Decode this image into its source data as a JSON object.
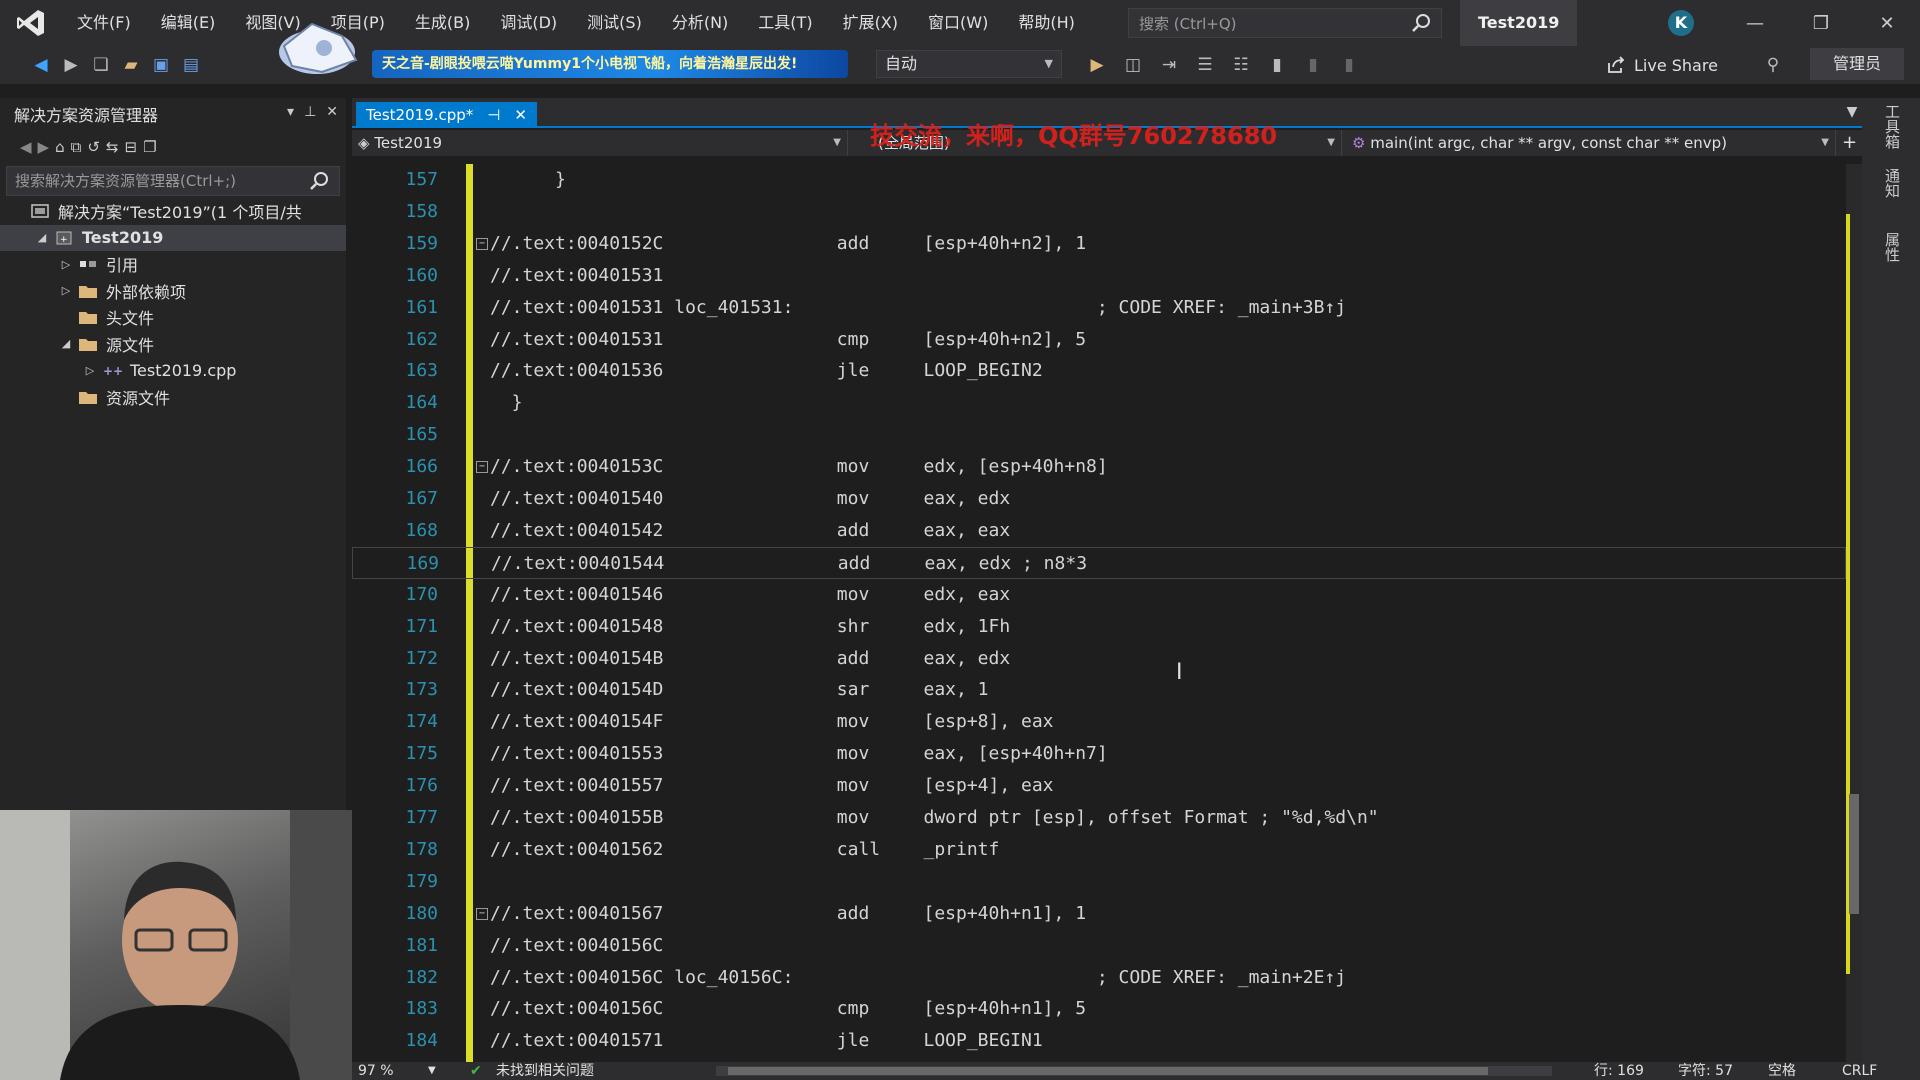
{
  "menu": [
    "文件(F)",
    "编辑(E)",
    "视图(V)",
    "项目(P)",
    "生成(B)",
    "调试(D)",
    "测试(S)",
    "分析(N)",
    "工具(T)",
    "扩展(X)",
    "窗口(W)",
    "帮助(H)"
  ],
  "title_search_placeholder": "搜索 (Ctrl+Q)",
  "solution_title": "Test2019",
  "account_initial": "K",
  "toolbar": {
    "banner_text": "天之音-剧眼投喂云喵Yummy1个小电视飞船，向着浩瀚星辰出发!",
    "config_value": "自动",
    "live_share": "Live Share",
    "admin_label": "管理员"
  },
  "solution_explorer": {
    "title": "解决方案资源管理器",
    "search_placeholder": "搜索解决方案资源管理器(Ctrl+;)",
    "items": [
      {
        "label": "解决方案“Test2019”(1 个项目/共",
        "indent": 0,
        "arrow": "",
        "icon": "solution-icon"
      },
      {
        "label": "Test2019",
        "indent": 1,
        "arrow": "◢",
        "icon": "project-icon",
        "bold": true,
        "selected": true
      },
      {
        "label": "引用",
        "indent": 2,
        "arrow": "▷",
        "icon": "references-icon"
      },
      {
        "label": "外部依赖项",
        "indent": 2,
        "arrow": "▷",
        "icon": "folder-icon"
      },
      {
        "label": "头文件",
        "indent": 2,
        "arrow": "",
        "icon": "folder-icon"
      },
      {
        "label": "源文件",
        "indent": 2,
        "arrow": "◢",
        "icon": "folder-icon"
      },
      {
        "label": "Test2019.cpp",
        "indent": 3,
        "arrow": "▷",
        "icon": "cpp-file-icon"
      },
      {
        "label": "资源文件",
        "indent": 2,
        "arrow": "",
        "icon": "folder-icon"
      }
    ]
  },
  "editor": {
    "tab_label": "Test2019.cpp*",
    "nav_project": "Test2019",
    "nav_scope": "(全局范围)",
    "nav_function": "main(int argc, char ** argv, const char ** envp)",
    "watermark": "技交流，来啊，QQ群号760278680",
    "current_line": 169,
    "lines": [
      {
        "n": "157",
        "text": "      }",
        "fold": false
      },
      {
        "n": "158",
        "text": "",
        "fold": false
      },
      {
        "n": "159",
        "text": "//.text:0040152C                add     [esp+40h+n2], 1",
        "fold": true
      },
      {
        "n": "160",
        "text": "//.text:00401531",
        "fold": false
      },
      {
        "n": "161",
        "text": "//.text:00401531 loc_401531:                            ; CODE XREF: _main+3B↑j",
        "fold": false
      },
      {
        "n": "162",
        "text": "//.text:00401531                cmp     [esp+40h+n2], 5",
        "fold": false
      },
      {
        "n": "163",
        "text": "//.text:00401536                jle     LOOP_BEGIN2",
        "fold": false
      },
      {
        "n": "164",
        "text": "  }",
        "fold": false
      },
      {
        "n": "165",
        "text": "",
        "fold": false
      },
      {
        "n": "166",
        "text": "//.text:0040153C                mov     edx, [esp+40h+n8]",
        "fold": true
      },
      {
        "n": "167",
        "text": "//.text:00401540                mov     eax, edx",
        "fold": false
      },
      {
        "n": "168",
        "text": "//.text:00401542                add     eax, eax",
        "fold": false
      },
      {
        "n": "169",
        "text": "//.text:00401544                add     eax, edx ; n8*3",
        "fold": false
      },
      {
        "n": "170",
        "text": "//.text:00401546                mov     edx, eax",
        "fold": false
      },
      {
        "n": "171",
        "text": "//.text:00401548                shr     edx, 1Fh",
        "fold": false
      },
      {
        "n": "172",
        "text": "//.text:0040154B                add     eax, edx",
        "fold": false
      },
      {
        "n": "173",
        "text": "//.text:0040154D                sar     eax, 1",
        "fold": false
      },
      {
        "n": "174",
        "text": "//.text:0040154F                mov     [esp+8], eax",
        "fold": false
      },
      {
        "n": "175",
        "text": "//.text:00401553                mov     eax, [esp+40h+n7]",
        "fold": false
      },
      {
        "n": "176",
        "text": "//.text:00401557                mov     [esp+4], eax",
        "fold": false
      },
      {
        "n": "177",
        "text": "//.text:0040155B                mov     dword ptr [esp], offset Format ; \"%d,%d\\n\"",
        "fold": false
      },
      {
        "n": "178",
        "text": "//.text:00401562                call    _printf",
        "fold": false
      },
      {
        "n": "179",
        "text": "",
        "fold": false
      },
      {
        "n": "180",
        "text": "//.text:00401567                add     [esp+40h+n1], 1",
        "fold": true
      },
      {
        "n": "181",
        "text": "//.text:0040156C",
        "fold": false
      },
      {
        "n": "182",
        "text": "//.text:0040156C loc_40156C:                            ; CODE XREF: _main+2E↑j",
        "fold": false
      },
      {
        "n": "183",
        "text": "//.text:0040156C                cmp     [esp+40h+n1], 5",
        "fold": false
      },
      {
        "n": "184",
        "text": "//.text:00401571                jle     LOOP_BEGIN1",
        "fold": false
      }
    ]
  },
  "right_rail": [
    "工具箱",
    "通知",
    "属性"
  ],
  "status": {
    "zoom": "97 %",
    "issues": "未找到相关问题",
    "line": "行: 169",
    "char": "字符: 57",
    "spaces": "空格",
    "eol": "CRLF"
  },
  "colors": {
    "accent": "#007acc",
    "line_number": "#2b91af",
    "change_bar": "#dcdc2a",
    "watermark": "#e0201b"
  }
}
